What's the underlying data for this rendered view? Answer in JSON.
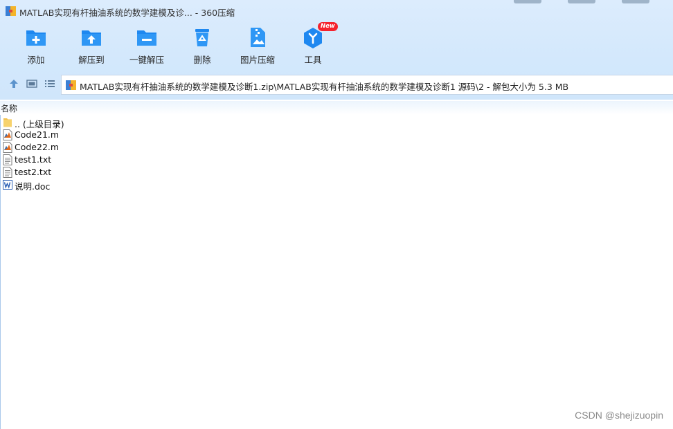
{
  "window": {
    "title": "MATLAB实现有杆抽油系统的数学建模及诊... - 360压缩"
  },
  "toolbar": {
    "items": [
      {
        "label": "添加",
        "icon": "folder-plus-icon"
      },
      {
        "label": "解压到",
        "icon": "folder-upload-icon"
      },
      {
        "label": "一键解压",
        "icon": "folder-minus-icon"
      },
      {
        "label": "删除",
        "icon": "recycle-bin-icon"
      },
      {
        "label": "图片压缩",
        "icon": "image-zip-icon"
      },
      {
        "label": "工具",
        "icon": "tools-cube-icon",
        "badge": "New"
      }
    ]
  },
  "navigation": {
    "buttons": [
      "up-arrow-icon",
      "thumbnail-view-icon",
      "list-view-icon"
    ],
    "path": "MATLAB实现有杆抽油系统的数学建模及诊断1.zip\\MATLAB实现有杆抽油系统的数学建模及诊断1 源码\\2",
    "size_info": " - 解包大小为 5.3 MB"
  },
  "list": {
    "column_name": "名称",
    "files": [
      {
        "name": ".. (上级目录)",
        "icon": "folder-icon"
      },
      {
        "name": "Code21.m",
        "icon": "matlab-file-icon"
      },
      {
        "name": "Code22.m",
        "icon": "matlab-file-icon"
      },
      {
        "name": "test1.txt",
        "icon": "text-file-icon"
      },
      {
        "name": "test2.txt",
        "icon": "text-file-icon"
      },
      {
        "name": "说明.doc",
        "icon": "word-doc-icon"
      }
    ]
  },
  "watermark": "CSDN @shejizuopin",
  "colors": {
    "accent": "#1e88f0",
    "chrome_background": "#d3e8fc",
    "badge": "#f5222d"
  }
}
